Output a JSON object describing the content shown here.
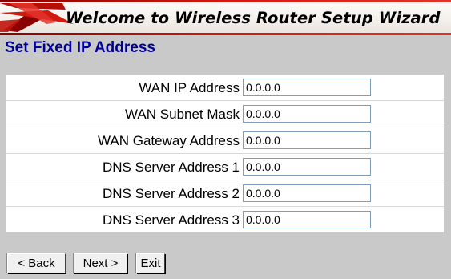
{
  "banner": {
    "title": "Welcome to Wireless Router Setup Wizard",
    "logo_icon": "red-swoosh-logo-icon",
    "accent_color": "#d11a10"
  },
  "page": {
    "title": "Set Fixed IP Address",
    "title_color": "#000099"
  },
  "form": {
    "fields": [
      {
        "label": "WAN IP Address",
        "value": "0.0.0.0"
      },
      {
        "label": "WAN Subnet Mask",
        "value": "0.0.0.0"
      },
      {
        "label": "WAN Gateway Address",
        "value": "0.0.0.0"
      },
      {
        "label": "DNS Server Address 1",
        "value": "0.0.0.0"
      },
      {
        "label": "DNS Server Address 2",
        "value": "0.0.0.0"
      },
      {
        "label": "DNS Server Address 3",
        "value": "0.0.0.0"
      }
    ]
  },
  "buttons": {
    "back_label": "< Back",
    "next_label": "Next >",
    "exit_label": "Exit"
  }
}
